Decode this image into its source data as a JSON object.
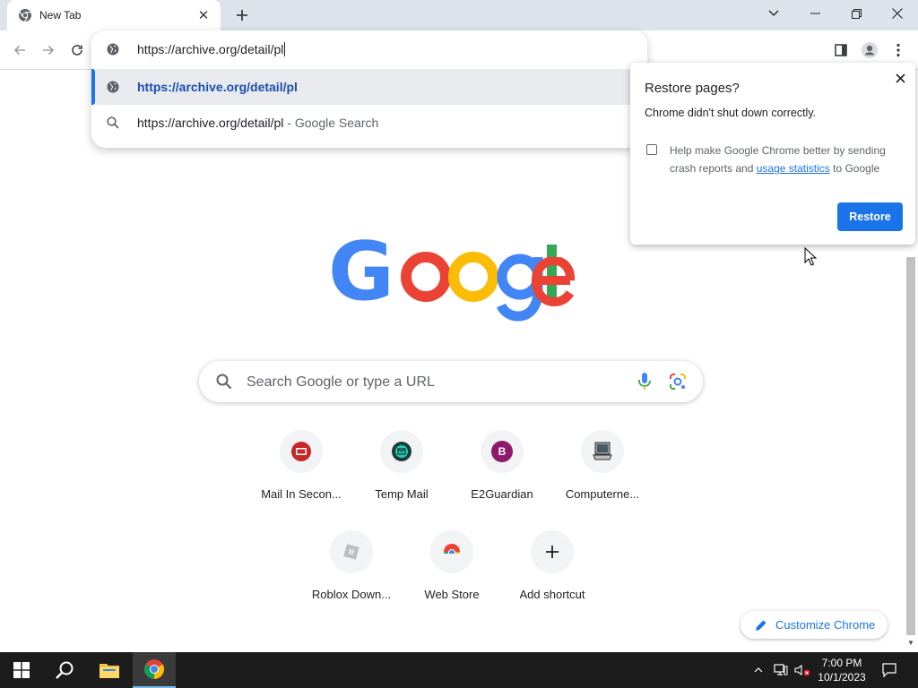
{
  "tab": {
    "title": "New Tab"
  },
  "omnibox": {
    "input_text": "https://archive.org/detail/pl",
    "suggestions": [
      {
        "text": "https://archive.org/detail/pl"
      },
      {
        "text": "https://archive.org/detail/pl",
        "separator": "-",
        "suffix": "Google Search"
      }
    ]
  },
  "popup": {
    "title": "Restore pages?",
    "message": "Chrome didn't shut down correctly.",
    "help_prefix": "Help make Google Chrome better by sending crash reports and",
    "help_link": "usage statistics",
    "help_suffix": "to Google",
    "restore_label": "Restore"
  },
  "search": {
    "placeholder": "Search Google or type a URL"
  },
  "shortcuts": [
    {
      "label": "Mail In Secon..."
    },
    {
      "label": "Temp Mail"
    },
    {
      "label": "E2Guardian",
      "initial": "B"
    },
    {
      "label": "Computerne..."
    },
    {
      "label": "Roblox Down..."
    },
    {
      "label": "Web Store"
    },
    {
      "label": "Add shortcut"
    }
  ],
  "customize": {
    "label": "Customize Chrome"
  },
  "clock": {
    "time": "7:00 PM",
    "date": "10/1/2023"
  },
  "colors": {
    "accent": "#1a73e8",
    "taskbar": "#1c1c1c"
  }
}
